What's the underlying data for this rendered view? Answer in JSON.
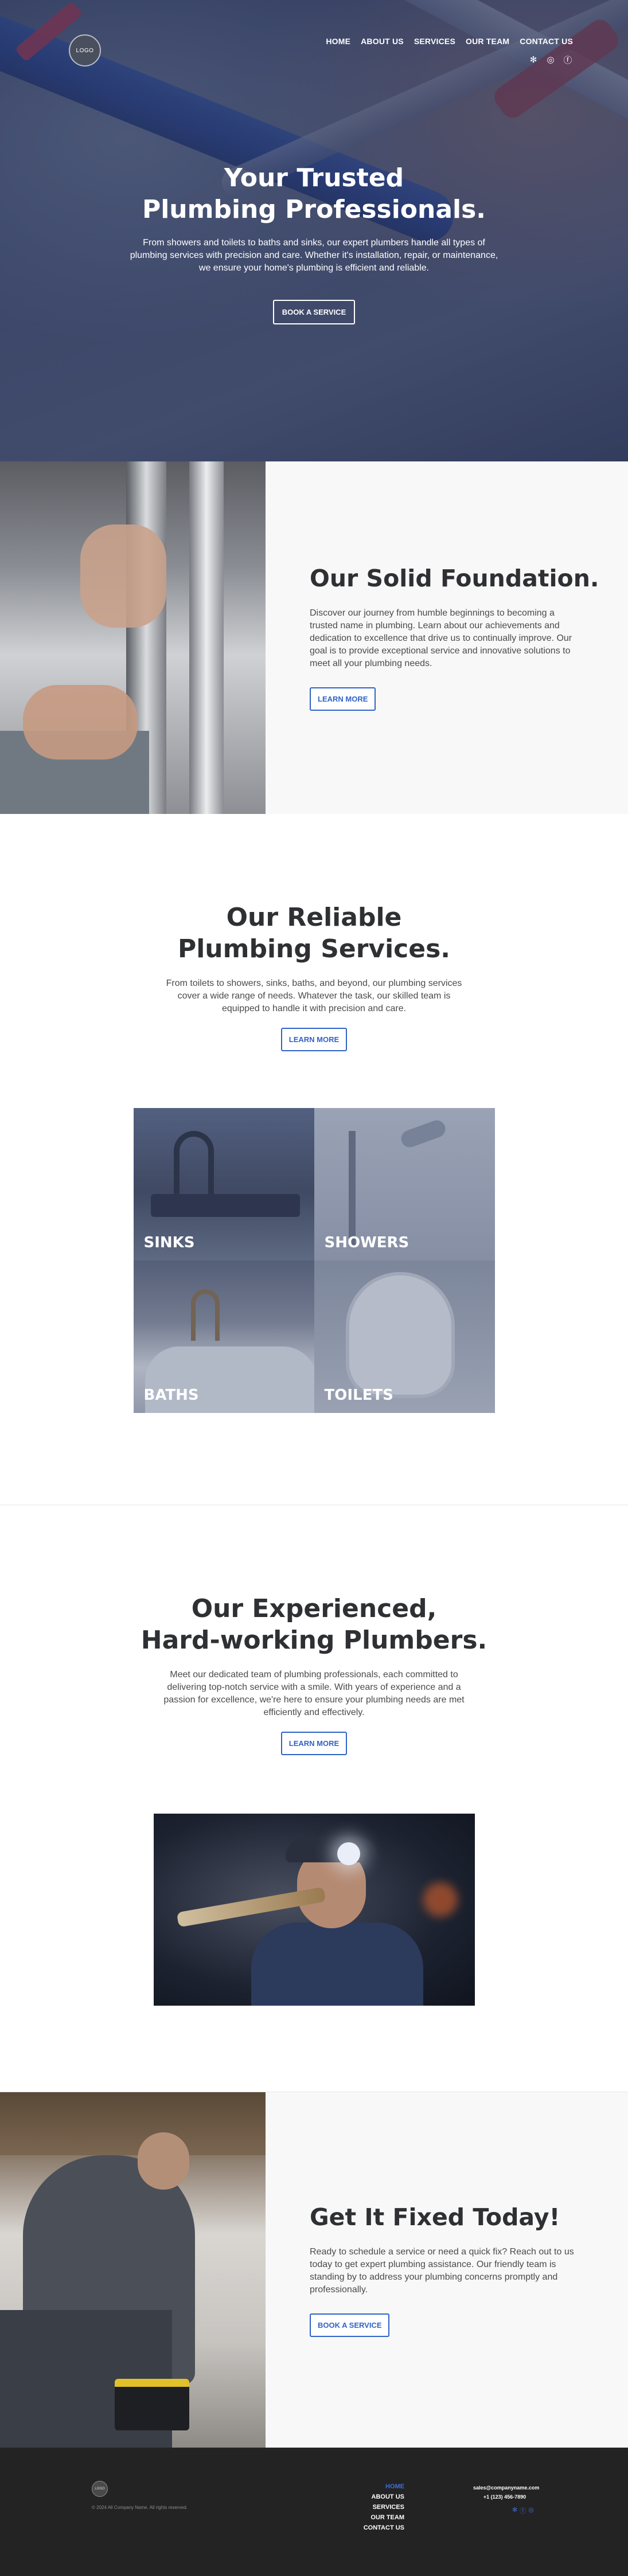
{
  "header": {
    "logo": "LOGO",
    "nav": [
      "HOME",
      "ABOUT US",
      "SERVICES",
      "OUR TEAM",
      "CONTACT US"
    ],
    "social_icons": [
      "yelp-icon",
      "instagram-icon",
      "facebook-icon"
    ]
  },
  "hero": {
    "title_line1": "Your Trusted",
    "title_line2": "Plumbing Professionals.",
    "text": "From showers and toilets to baths and sinks, our expert plumbers handle all types of plumbing services with precision and care. Whether it's installation, repair, or maintenance, we ensure your home's plumbing is efficient and reliable.",
    "button": "BOOK A SERVICE"
  },
  "foundation": {
    "title": "Our Solid Foundation.",
    "text": "Discover our journey from humble beginnings to becoming a trusted name in plumbing. Learn about our achievements and dedication to excellence that drive us to continually improve. Our goal is to provide exceptional service and innovative solutions to meet all your plumbing needs.",
    "button": "LEARN MORE"
  },
  "services": {
    "title_line1": "Our Reliable",
    "title_line2": "Plumbing Services.",
    "text": "From toilets to showers, sinks, baths, and beyond, our plumbing services cover a wide range of needs. Whatever the task, our skilled team is equipped to handle it with precision and care.",
    "button": "LEARN MORE",
    "tiles": [
      "SINKS",
      "SHOWERS",
      "BATHS",
      "TOILETS"
    ]
  },
  "team": {
    "title_line1": "Our Experienced,",
    "title_line2": "Hard-working Plumbers.",
    "text": "Meet our dedicated team of plumbing professionals, each committed to delivering top-notch service with a smile. With years of experience and a passion for excellence, we're here to ensure your plumbing needs are met efficiently and effectively.",
    "button": "LEARN MORE"
  },
  "fix": {
    "title": "Get It Fixed Today!",
    "text": "Ready to schedule a service or need a quick fix? Reach out to us today to get expert plumbing assistance. Our friendly team is standing by to address your plumbing concerns promptly and professionally.",
    "button": "BOOK A SERVICE"
  },
  "footer": {
    "logo": "LOGO",
    "copyright": "© 2024 All Company Name. All rights reserved.",
    "nav": [
      "HOME",
      "ABOUT US",
      "SERVICES",
      "OUR TEAM",
      "CONTACT US"
    ],
    "email": "sales@companyname.com",
    "phone": "+1 (123) 456-7890",
    "social_icons": [
      "yelp-icon",
      "facebook-icon",
      "instagram-icon"
    ],
    "accent_color": "#3f6fd6"
  }
}
